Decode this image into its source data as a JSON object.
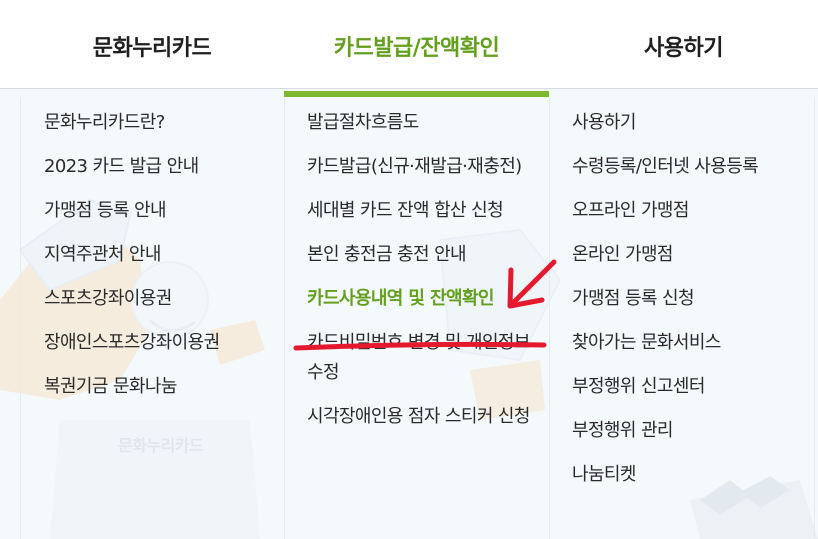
{
  "topnav": {
    "tabs": [
      {
        "label": "문화누리카드",
        "active": false
      },
      {
        "label": "카드발급/잔액확인",
        "active": true
      },
      {
        "label": "사용하기",
        "active": false
      }
    ]
  },
  "columns": {
    "col1": [
      "문화누리카드란?",
      "2023 카드 발급 안내",
      "가맹점 등록 안내",
      "지역주관처 안내",
      "스포츠강좌이용권",
      "장애인스포츠강좌이용권",
      "복권기금 문화나눔"
    ],
    "col2": [
      "발급절차흐름도",
      "카드발급(신규·재발급·재충전)",
      "세대별 카드 잔액 합산 신청",
      "본인 충전금 충전 안내",
      "카드사용내역 및 잔액확인",
      "카드비밀번호 변경 및 개인정보수정",
      "시각장애인용 점자 스티커 신청"
    ],
    "col3": [
      "사용하기",
      "수령등록/인터넷 사용등록",
      "오프라인 가맹점",
      "온라인 가맹점",
      "가맹점 등록 신청",
      "찾아가는 문화서비스",
      "부정행위 신고센터",
      "부정행위 관리",
      "나눔티켓"
    ]
  },
  "background": {
    "watermark": "문화누리카드"
  },
  "colors": {
    "accent": "#63a01e",
    "underline": "#7fb82e",
    "annotation": "#e5192d",
    "panel_bg": "#f4f9fc"
  }
}
